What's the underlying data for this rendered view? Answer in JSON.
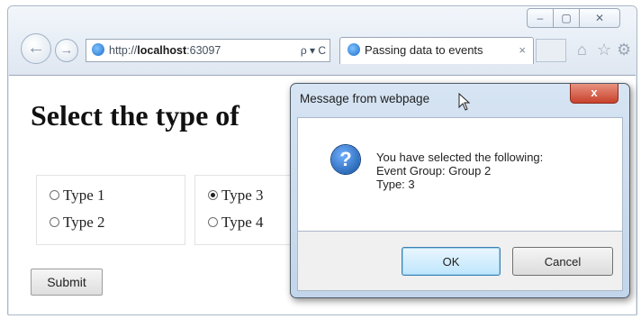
{
  "browser": {
    "window_controls": {
      "minimize": "–",
      "maximize": "▢",
      "close": "✕"
    },
    "back_icon": "back-arrow-icon",
    "forward_icon": "forward-arrow-icon",
    "address": {
      "scheme": "http://",
      "host": "localhost",
      "rest": ":63097",
      "tools": "ρ ▾ C"
    },
    "tab": {
      "title": "Passing data to events",
      "close": "×"
    },
    "toolbar_icons": [
      "home-icon",
      "star-icon",
      "gear-icon"
    ]
  },
  "page": {
    "title": "Select the type of",
    "groups": [
      {
        "options": [
          {
            "label": "Type 1",
            "checked": false
          },
          {
            "label": "Type 2",
            "checked": false
          }
        ]
      },
      {
        "options": [
          {
            "label": "Type 3",
            "checked": true
          },
          {
            "label": "Type 4",
            "checked": false
          }
        ]
      }
    ],
    "submit_label": "Submit"
  },
  "dialog": {
    "title": "Message from webpage",
    "close_label": "x",
    "icon": "question-icon",
    "message": [
      "You have selected the following:",
      "Event Group: Group 2",
      "Type: 3"
    ],
    "ok_label": "OK",
    "cancel_label": "Cancel"
  },
  "colors": {
    "dialog_frame": "#c8d8ec",
    "close_button": "#c8422d",
    "ok_button": "#bee6fd"
  }
}
